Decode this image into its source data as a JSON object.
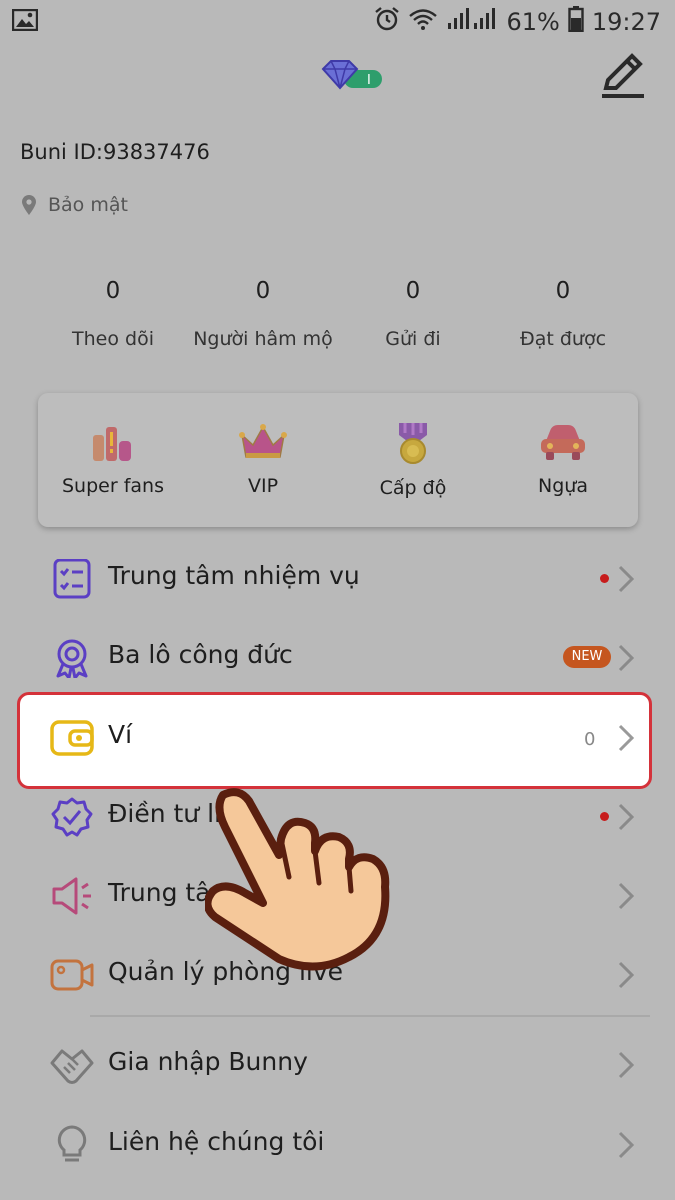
{
  "status_bar": {
    "battery": "61%",
    "time": "19:27",
    "icons": [
      "image-icon",
      "alarm-icon",
      "wifi-icon",
      "signal-icon",
      "battery-icon"
    ]
  },
  "header": {
    "level_badge": "I",
    "icons": [
      "diamond-icon",
      "edit-icon"
    ]
  },
  "profile": {
    "user_id": "Buni ID:93837476",
    "location": "Bảo mật"
  },
  "stats": [
    {
      "value": "0",
      "label": "Theo dõi"
    },
    {
      "value": "0",
      "label": "Người hâm mộ"
    },
    {
      "value": "0",
      "label": "Gửi đi"
    },
    {
      "value": "0",
      "label": "Đạt được"
    }
  ],
  "features": [
    {
      "label": "Super fans",
      "icon": "super-fans-icon"
    },
    {
      "label": "VIP",
      "icon": "crown-icon"
    },
    {
      "label": "Cấp độ",
      "icon": "medal-icon"
    },
    {
      "label": "Ngựa",
      "icon": "car-icon"
    }
  ],
  "menu": [
    {
      "label": "Trung tâm nhiệm vụ",
      "icon": "task-list-icon",
      "red_dot": true
    },
    {
      "label": "Ba lô công đức",
      "icon": "badge-icon",
      "badge": "NEW"
    },
    {
      "label": "Ví",
      "icon": "wallet-icon",
      "value": "0",
      "highlighted": true
    },
    {
      "label": "Điền tư li",
      "icon": "verify-icon",
      "red_dot": true
    },
    {
      "label": "Trung tâ",
      "icon": "megaphone-icon"
    },
    {
      "label": "Quản lý phòng live",
      "icon": "camera-icon"
    },
    {
      "label": "Gia nhập Bunny",
      "icon": "handshake-icon"
    },
    {
      "label": "Liên hệ chúng tôi",
      "icon": "lightbulb-icon"
    }
  ],
  "colors": {
    "overlay_bg": "#b9b9b9",
    "highlight_border": "#d4323a",
    "red_dot": "#c71c1c",
    "new_badge": "#c5561f",
    "icon_purple": "#5b3fc4",
    "wallet_yellow": "#e6b817",
    "hand_skin": "#f5c89a",
    "hand_outline": "#5a1f0f"
  }
}
